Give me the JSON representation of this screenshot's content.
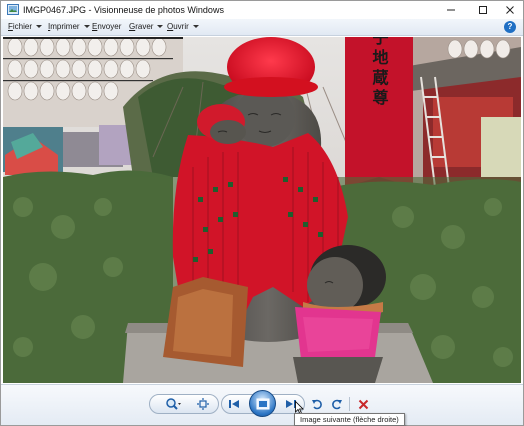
{
  "window": {
    "title": "IMGP0467.JPG - Visionneuse de photos Windows"
  },
  "menu": {
    "items": [
      {
        "label": "Fichier",
        "underline": "F",
        "rest": "ichier"
      },
      {
        "label": "Imprimer",
        "underline": "I",
        "rest": "mprimer"
      },
      {
        "label": "Envoyer",
        "underline": "E",
        "rest": "nvoyer"
      },
      {
        "label": "Graver",
        "underline": "G",
        "rest": "raver"
      },
      {
        "label": "Ouvrir",
        "underline": "O",
        "rest": "uvrir"
      }
    ],
    "help_label": "?"
  },
  "photo": {
    "banner_text": "母子地蔵尊",
    "description_colors": {
      "hat": "#e0142a",
      "shawl": "#d11428",
      "pink_bib": "#e2358f",
      "stone": "#5b5955",
      "hedge": "#4d6b3b"
    }
  },
  "toolbar": {
    "tooltip": "Image suivante (flèche droite)"
  },
  "colors": {
    "accent": "#2a74c4",
    "menubar": "#e1e9f3",
    "delete_red": "#c8282b"
  }
}
